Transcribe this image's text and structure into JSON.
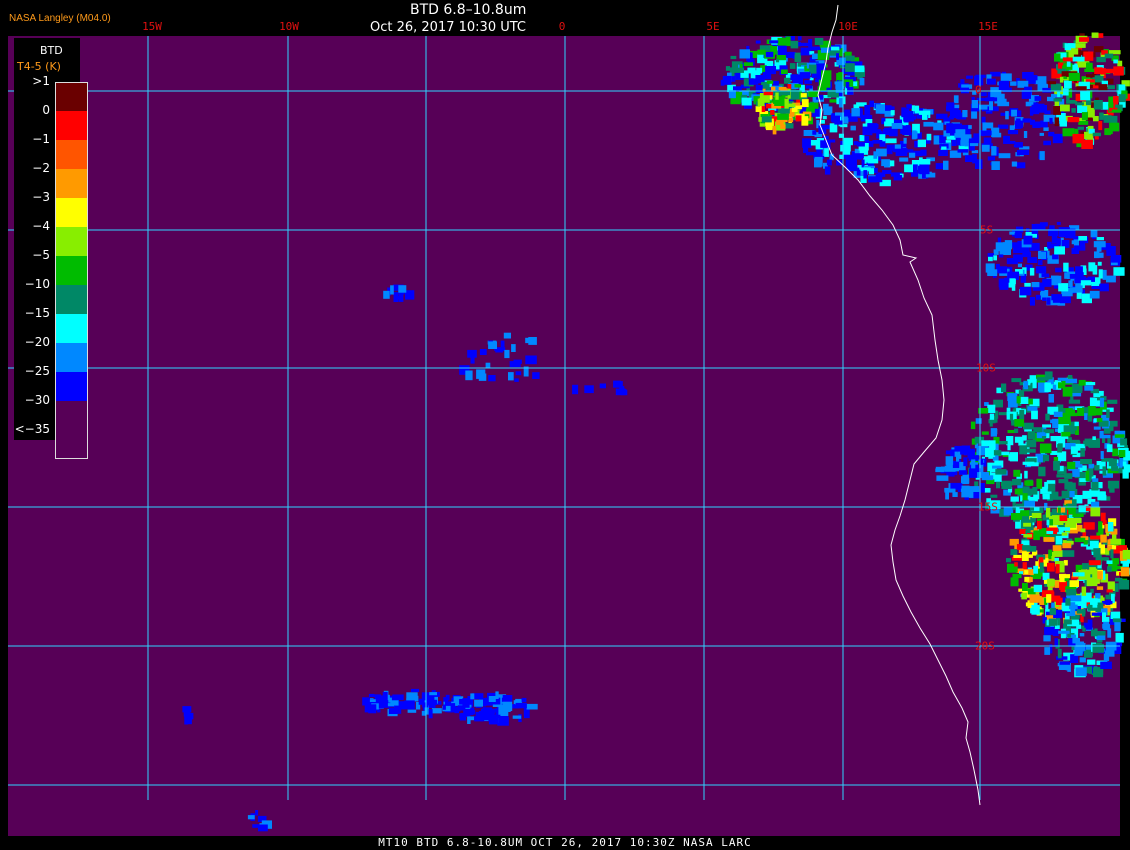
{
  "header": {
    "title": "BTD 6.8–10.8um",
    "datetime": "Oct 26, 2017 10:30 UTC",
    "provider": "NASA Langley (M04.0)"
  },
  "legend": {
    "title": "BTD",
    "subtitle": "T4-5 (K)",
    "levels": [
      {
        "label": ">1",
        "color": "#6a0000"
      },
      {
        "label": "0",
        "color": "#ff0000"
      },
      {
        "label": "−1",
        "color": "#ff5500"
      },
      {
        "label": "−2",
        "color": "#ff9a00"
      },
      {
        "label": "−3",
        "color": "#ffff00"
      },
      {
        "label": "−4",
        "color": "#88ee00"
      },
      {
        "label": "−5",
        "color": "#00bb00"
      },
      {
        "label": "−10",
        "color": "#008866"
      },
      {
        "label": "−15",
        "color": "#00ffff"
      },
      {
        "label": "−20",
        "color": "#0088ff"
      },
      {
        "label": "−25",
        "color": "#0000ff"
      },
      {
        "label": "−30",
        "color": "#570057"
      },
      {
        "label": "<−35",
        "color": "#570057"
      }
    ]
  },
  "grid": {
    "lon_labels": [
      "15W",
      "10W",
      "0",
      "5E",
      "10E",
      "15E"
    ],
    "lat_labels": [
      "0",
      "5S",
      "10S",
      "15S",
      "20S"
    ]
  },
  "colors": {
    "background": "#570057",
    "grid": "#2fd3ff",
    "coast": "#ffffff",
    "label": "#e01010"
  },
  "footer": {
    "text": "MT10  BTD 6.8-10.8UM   OCT 26, 2017 10:30Z   NASA LARC"
  }
}
